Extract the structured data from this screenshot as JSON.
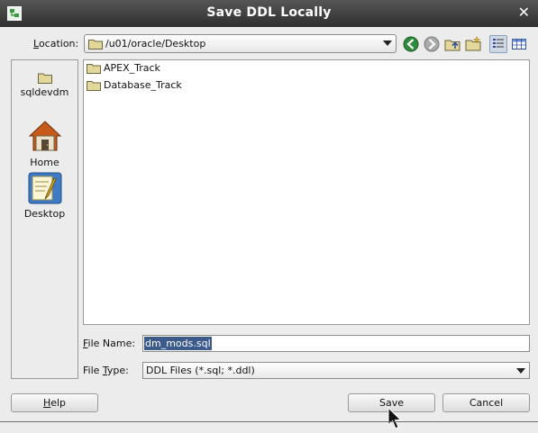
{
  "window": {
    "title": "Save DDL Locally",
    "close_glyph": "✕"
  },
  "location": {
    "label_mnemonic": "L",
    "label_rest": "ocation:",
    "path": "/u01/oracle/Desktop"
  },
  "toolbar": {
    "icons": [
      "back-icon",
      "forward-icon",
      "up-folder-icon",
      "new-folder-icon",
      "list-view-icon",
      "details-view-icon"
    ],
    "selected_view": "list-view-icon"
  },
  "places": [
    {
      "label": "sqldevdm",
      "icon": "folder-icon"
    },
    {
      "label": "Home",
      "icon": "home-icon"
    },
    {
      "label": "Desktop",
      "icon": "desktop-icon"
    }
  ],
  "files": [
    {
      "name": "APEX_Track",
      "icon": "folder-icon"
    },
    {
      "name": "Database_Track",
      "icon": "folder-icon"
    }
  ],
  "file_name": {
    "label_mnemonic": "F",
    "label_rest": "ile Name:",
    "value": "dm_mods.sql"
  },
  "file_type": {
    "label_pre": "File ",
    "label_mnemonic": "T",
    "label_post": "ype:",
    "value": "DDL Files (*.sql; *.ddl)"
  },
  "buttons": {
    "help_mnemonic": "H",
    "help_rest": "elp",
    "save": "Save",
    "cancel": "Cancel"
  },
  "colors": {
    "titlebar": "#3f3f3f",
    "selection": "#3c5a8a",
    "back_forward_green": "#2e8b3a"
  }
}
